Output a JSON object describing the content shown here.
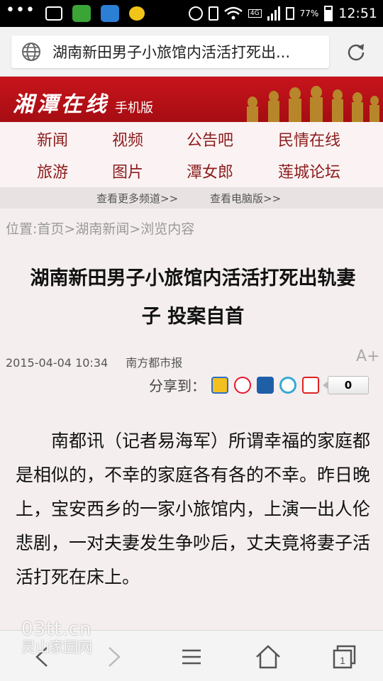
{
  "status_bar": {
    "battery": "77%",
    "time": "12:51",
    "network": "4G"
  },
  "url_bar": {
    "title": "湖南新田男子小旅馆内活活打死出..."
  },
  "banner": {
    "logo": "湘潭在线",
    "sub": "手机版"
  },
  "nav": {
    "items": [
      "新闻",
      "视频",
      "公告吧",
      "民情在线",
      "旅游",
      "图片",
      "潭女郎",
      "莲城论坛"
    ],
    "more_channels": "查看更多频道>>",
    "pc_version": "查看电脑版>>"
  },
  "breadcrumb": "位置:首页>湖南新闻>浏览内容",
  "article": {
    "title_line1": "湖南新田男子小旅馆内活活打死出轨妻",
    "title_line2": "子 投案自首",
    "date": "2015-04-04 10:34",
    "source": "南方都市报",
    "font_size_btn": "A+",
    "share_label": "分享到：",
    "share_count": "0",
    "share_icons": [
      "qzone-icon",
      "weibo-icon",
      "renren-icon",
      "tencent-weibo-icon",
      "kaixin-icon"
    ],
    "body": "南都讯（记者易海军）所谓幸福的家庭都是相似的，不幸的家庭各有各的不幸。昨日晚上，宝安西乡的一家小旅馆内，上演一出人伦悲剧，一对夫妻发生争吵后，丈夫竟将妻子活活打死在床上。"
  },
  "watermark": {
    "line1": "03tt.cn",
    "line2": "灵山家园网"
  },
  "colors": {
    "banner_red": "#c8141c",
    "nav_text": "#8c1c1c"
  }
}
